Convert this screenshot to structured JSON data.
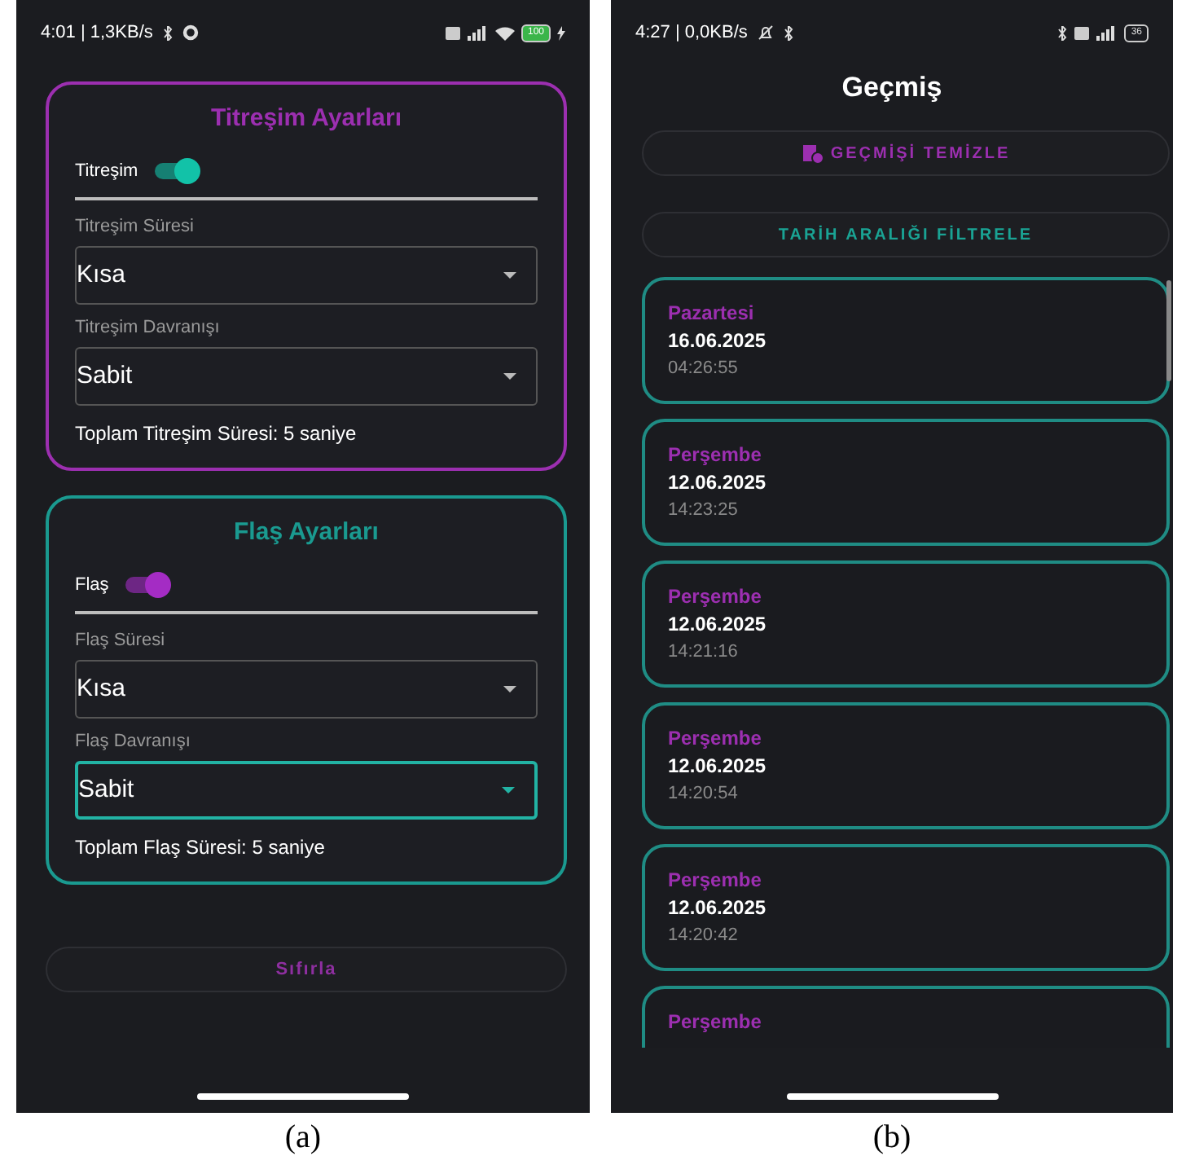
{
  "settings_screen": {
    "status_bar": {
      "time": "4:01 | 1,3KB/s",
      "battery": "100"
    },
    "sections": [
      {
        "title": "Titreşim Ayarları",
        "color": "#9c2fb0",
        "toggle": {
          "label": "Titreşim",
          "on": true,
          "color": "#12c2a8"
        },
        "fields": [
          {
            "label": "Titreşim Süresi",
            "value": "Kısa",
            "focused": false
          },
          {
            "label": "Titreşim Davranışı",
            "value": "Sabit",
            "focused": false
          }
        ],
        "total": "Toplam Titreşim Süresi: 5 saniye"
      },
      {
        "title": "Flaş Ayarları",
        "color": "#1a9a90",
        "toggle": {
          "label": "Flaş",
          "on": true,
          "color": "#a42cc4"
        },
        "fields": [
          {
            "label": "Flaş Süresi",
            "value": "Kısa",
            "focused": false
          },
          {
            "label": "Flaş Davranışı",
            "value": "Sabit",
            "focused": true
          }
        ],
        "total": "Toplam Flaş Süresi: 5 saniye"
      }
    ],
    "reset_button": "Sıfırla",
    "caption": "(a)"
  },
  "history_screen": {
    "status_bar": {
      "time": "4:27 | 0,0KB/s",
      "battery": "36"
    },
    "title": "Geçmiş",
    "buttons": [
      {
        "label": "GEÇMİŞİ TEMİZLE",
        "kind": "clear"
      },
      {
        "label": "TARİH ARALIĞI FİLTRELE",
        "kind": "filter"
      }
    ],
    "entries": [
      {
        "day": "Pazartesi",
        "date": "16.06.2025",
        "time": "04:26:55"
      },
      {
        "day": "Perşembe",
        "date": "12.06.2025",
        "time": "14:23:25"
      },
      {
        "day": "Perşembe",
        "date": "12.06.2025",
        "time": "14:21:16"
      },
      {
        "day": "Perşembe",
        "date": "12.06.2025",
        "time": "14:20:54"
      },
      {
        "day": "Perşembe",
        "date": "12.06.2025",
        "time": "14:20:42"
      },
      {
        "day": "Perşembe"
      }
    ],
    "caption": "(b)"
  }
}
